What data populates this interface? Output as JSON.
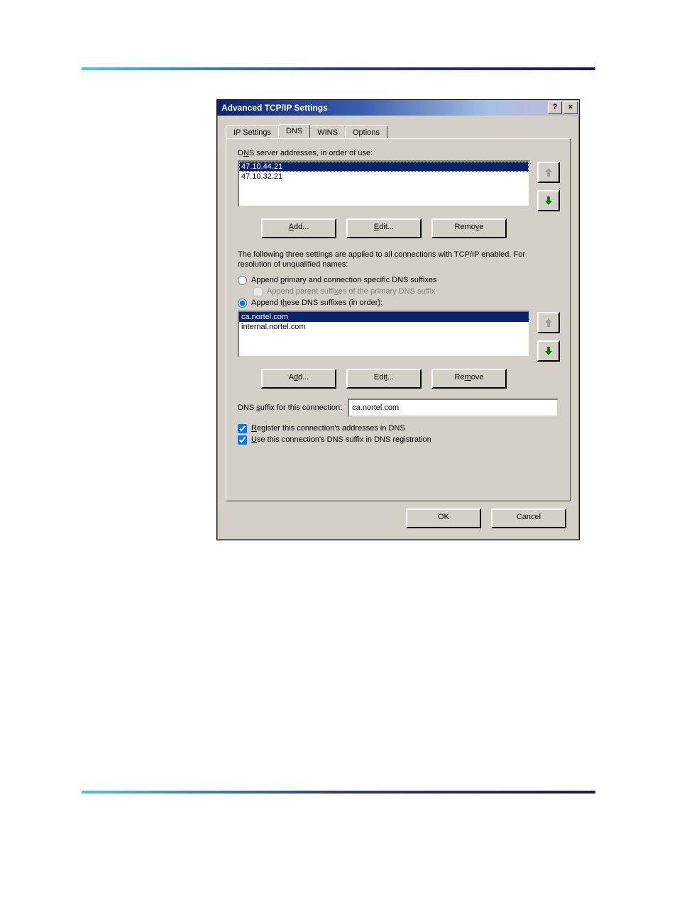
{
  "window": {
    "title": "Advanced TCP/IP Settings",
    "help_glyph": "?",
    "close_glyph": "×"
  },
  "tabs": {
    "ip_settings": "IP Settings",
    "dns": "DNS",
    "wins": "WINS",
    "options": "Options"
  },
  "dns": {
    "server_list_label_pre": "D",
    "server_list_label_mn": "N",
    "server_list_label_post": "S server addresses, in order of use:",
    "servers": [
      "47.10.44.21",
      "47.10.32.21"
    ],
    "btn_add": "Add...",
    "btn_add_mn": "A",
    "btn_edit": "Edit...",
    "btn_edit_mn": "E",
    "btn_remove": "Remove",
    "btn_remove_mn": "v",
    "btn_remove_pre": "Remo",
    "btn_remove_post": "e",
    "explain": "The following three settings are applied to all connections with TCP/IP enabled. For resolution of unqualified names:",
    "radio_primary_pre": "Append ",
    "radio_primary_mn": "p",
    "radio_primary_post": "rimary and connection specific DNS suffixes",
    "check_parent_pre": "Append parent suffi",
    "check_parent_mn": "x",
    "check_parent_post": "es of the primary DNS suffix",
    "radio_these_pre": "Append t",
    "radio_these_mn": "h",
    "radio_these_post": "ese DNS suffixes (in order):",
    "suffixes": [
      "ca.nortel.com",
      "internal.nortel.com"
    ],
    "btn_add2": "Add...",
    "btn_add2_mn": "d",
    "btn_add2_pre": "A",
    "btn_add2_post": "d...",
    "btn_edit2": "Edit...",
    "btn_edit2_mn": "t",
    "btn_edit2_pre": "Edi",
    "btn_edit2_post": "...",
    "btn_remove2": "Remove",
    "btn_remove2_mn": "m",
    "btn_remove2_pre": "Re",
    "btn_remove2_post": "ove",
    "suffix_conn_label_pre": "DNS ",
    "suffix_conn_label_mn": "s",
    "suffix_conn_label_post": "uffix for this connection:",
    "suffix_conn_value": "ca.nortel.com",
    "check_register_pre": "",
    "check_register_mn": "R",
    "check_register_post": "egister this connection's addresses in DNS",
    "check_usesuffix_pre": "",
    "check_usesuffix_mn": "U",
    "check_usesuffix_post": "se this connection's DNS suffix in DNS registration"
  },
  "buttons": {
    "ok": "OK",
    "cancel": "Cancel"
  }
}
